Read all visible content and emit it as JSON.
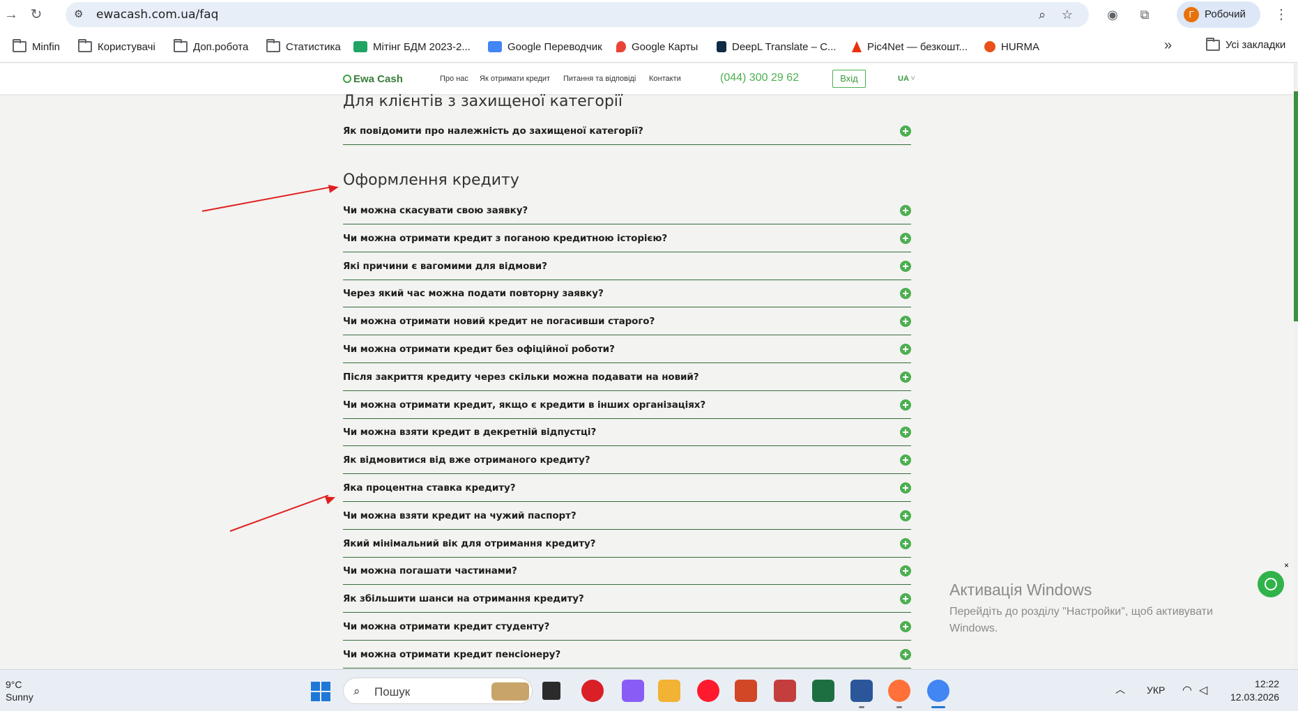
{
  "browser": {
    "url": "ewacash.com.ua/faq",
    "profile_initial": "Г",
    "profile_name": "Робочий",
    "bookmarks": [
      {
        "label": "Minfin",
        "icon": "folder-icon"
      },
      {
        "label": "Користувачі",
        "icon": "folder-icon"
      },
      {
        "label": "Доп.робота",
        "icon": "folder-icon"
      },
      {
        "label": "Статистика",
        "icon": "folder-icon"
      },
      {
        "label": "Мітінг БДМ 2023-2...",
        "icon": "sheets-icon"
      },
      {
        "label": "Google Переводчик",
        "icon": "translate-icon"
      },
      {
        "label": "Google Карты",
        "icon": "maps-icon"
      },
      {
        "label": "DeepL Translate – С...",
        "icon": "deepl-icon"
      },
      {
        "label": "Pic4Net — безкошт...",
        "icon": "pic4net-icon"
      },
      {
        "label": "HURMA",
        "icon": "hurma-icon"
      }
    ],
    "all_bookmarks": "Усі закладки",
    "more_bookmarks": "»"
  },
  "site": {
    "logo": "Ewa Cash",
    "nav": [
      "Про нас",
      "Як отримати кредит",
      "Питання та відповіді",
      "Контакти"
    ],
    "phone": "(044) 300 29 62",
    "login": "Вхід",
    "lang": "UA",
    "lang_caret": "˅"
  },
  "faq": {
    "section1_title": "Для клієнтів з захищеної категорії",
    "section1_items": [
      "Як повідомити про належність до захищеної категорії?"
    ],
    "section2_title": "Оформлення кредиту",
    "section2_items": [
      "Чи можна скасувати свою заявку?",
      "Чи можна отримати кредит з поганою кредитною історією?",
      "Які причини є вагомими для відмови?",
      "Через який час можна подати повторну заявку?",
      "Чи можна отримати новий кредит не погасивши старого?",
      "Чи можна отримати кредит без офіційної роботи?",
      "Після закриття кредиту через скільки можна подавати на новий?",
      "Чи можна отримати кредит, якщо є кредити в інших організаціях?",
      "Чи можна взяти кредит в декретній відпустці?",
      "Як відмовитися від вже отриманого кредиту?",
      "Яка процентна ставка кредиту?",
      "Чи можна взяти кредит на чужий паспорт?",
      "Який мінімальний вік для отримання кредиту?",
      "Чи можна погашати частинами?",
      "Як збільшити шанси на отримання кредиту?",
      "Чи можна отримати кредит студенту?",
      "Чи можна отримати кредит пенсіонеру?"
    ]
  },
  "windows_activation": {
    "title": "Активація Windows",
    "text": "Перейдіть до розділу \"Настройки\", щоб активувати Windows."
  },
  "chat_close": "×",
  "taskbar": {
    "temperature": "9°C",
    "weather": "Sunny",
    "search_placeholder": "Пошук",
    "language": "УКР",
    "time": "12:22",
    "date": "12.03.2026"
  },
  "colors": {
    "accent_green": "#4caf50",
    "divider_green": "#356b3a",
    "annotation_red": "#e02020"
  }
}
